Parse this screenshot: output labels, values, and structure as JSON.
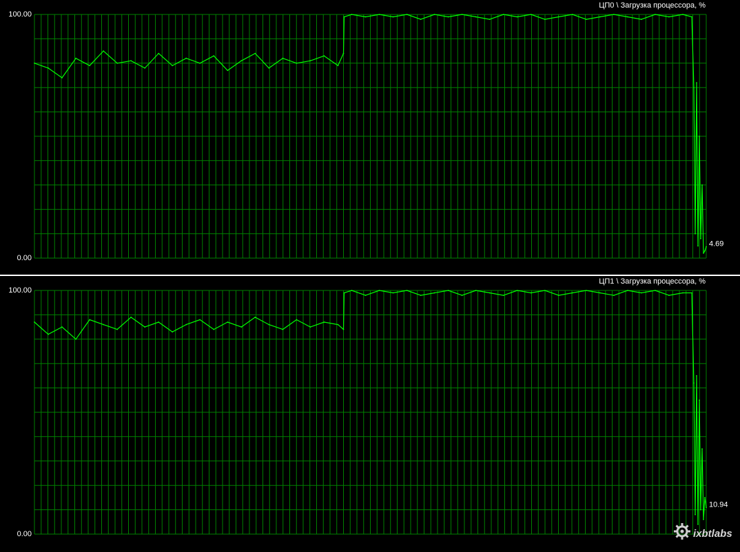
{
  "colors": {
    "background": "#000000",
    "grid": "#008000",
    "trace": "#00ff00",
    "text": "#ffffff",
    "separator": "#ffffff"
  },
  "watermark": {
    "text": "ixbtlabs",
    "icon": "gear-logo-icon"
  },
  "chart_data": [
    {
      "type": "line",
      "title": "ЦП0 \\ Загрузка процессора, %",
      "ylim": [
        0,
        100
      ],
      "y_tick_labels": [
        "100.00",
        "0.00"
      ],
      "current_value_label": "4.69",
      "grid": true,
      "x": [
        0,
        20,
        40,
        60,
        80,
        100,
        120,
        140,
        160,
        180,
        200,
        220,
        240,
        260,
        280,
        300,
        320,
        340,
        360,
        380,
        400,
        420,
        440,
        448,
        449,
        460,
        480,
        500,
        520,
        540,
        560,
        580,
        600,
        620,
        640,
        660,
        680,
        700,
        720,
        740,
        760,
        780,
        800,
        820,
        840,
        860,
        880,
        900,
        920,
        940,
        953,
        956,
        958,
        960,
        962,
        964,
        966,
        968,
        970,
        972,
        974
      ],
      "series": [
        {
          "values": [
            80,
            78,
            74,
            82,
            79,
            85,
            80,
            81,
            78,
            84,
            79,
            82,
            80,
            83,
            77,
            81,
            84,
            78,
            82,
            80,
            81,
            83,
            79,
            84,
            99,
            100,
            99,
            100,
            99,
            100,
            98,
            100,
            99,
            100,
            99,
            98,
            100,
            99,
            100,
            98,
            99,
            100,
            98,
            99,
            100,
            99,
            98,
            100,
            99,
            100,
            99,
            70,
            10,
            72,
            5,
            50,
            8,
            30,
            2,
            3,
            4.69
          ]
        }
      ]
    },
    {
      "type": "line",
      "title": "ЦП1 \\ Загрузка процессора, %",
      "ylim": [
        0,
        100
      ],
      "y_tick_labels": [
        "100.00",
        "0.00"
      ],
      "current_value_label": "10.94",
      "grid": true,
      "x": [
        0,
        20,
        40,
        60,
        80,
        100,
        120,
        140,
        160,
        180,
        200,
        220,
        240,
        260,
        280,
        300,
        320,
        340,
        360,
        380,
        400,
        420,
        440,
        448,
        449,
        460,
        480,
        500,
        520,
        540,
        560,
        580,
        600,
        620,
        640,
        660,
        680,
        700,
        720,
        740,
        760,
        780,
        800,
        820,
        840,
        860,
        880,
        900,
        920,
        940,
        953,
        956,
        958,
        960,
        962,
        964,
        966,
        968,
        970,
        972,
        974
      ],
      "series": [
        {
          "values": [
            87,
            82,
            85,
            80,
            88,
            86,
            84,
            89,
            85,
            87,
            83,
            86,
            88,
            84,
            87,
            85,
            89,
            86,
            84,
            88,
            85,
            87,
            86,
            84,
            99,
            100,
            98,
            100,
            99,
            100,
            98,
            99,
            100,
            98,
            100,
            99,
            98,
            100,
            99,
            100,
            98,
            99,
            100,
            99,
            98,
            100,
            99,
            100,
            98,
            99,
            99,
            62,
            8,
            65,
            4,
            55,
            10,
            35,
            6,
            15,
            10.94
          ]
        }
      ]
    }
  ]
}
